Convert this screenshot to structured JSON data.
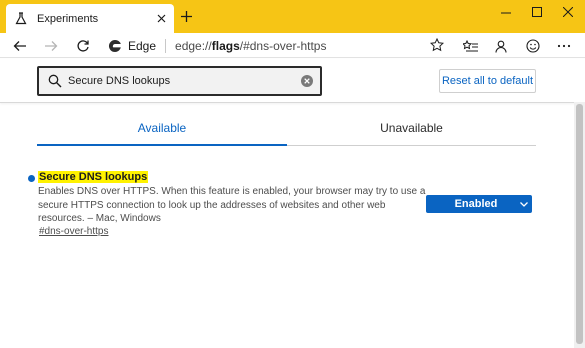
{
  "browser": {
    "tab_title": "Experiments",
    "edge_label": "Edge",
    "url_prefix": "edge://",
    "url_bold": "flags",
    "url_suffix": "/#dns-over-https"
  },
  "page": {
    "search": {
      "value": "Secure DNS lookups",
      "placeholder": "Search flags"
    },
    "reset_label": "Reset all to default",
    "tabs": [
      {
        "label": "Available",
        "active": true
      },
      {
        "label": "Unavailable",
        "active": false
      }
    ],
    "flag": {
      "name": "Secure DNS lookups",
      "description": "Enables DNS over HTTPS. When this feature is enabled, your browser may try to use a secure HTTPS connection to look up the addresses of websites and other web resources. – Mac, Windows",
      "link": "#dns-over-https",
      "selected": "Enabled"
    }
  },
  "colors": {
    "titlebar": "#f6c515",
    "accent": "#0a64c2",
    "highlight": "#fff200"
  }
}
